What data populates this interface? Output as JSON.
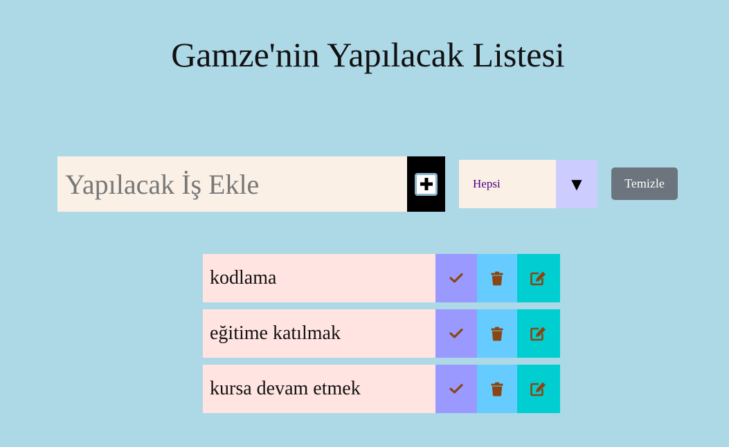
{
  "title": "Gamze'nin Yapılacak Listesi",
  "form": {
    "input_placeholder": "Yapılacak İş Ekle",
    "input_value": "",
    "add_icon": "plus-square-icon"
  },
  "filter": {
    "selected": "Hepsi",
    "arrow_icon": "triangle-down-icon"
  },
  "clear_button_label": "Temizle",
  "todos": [
    {
      "text": "kodlama"
    },
    {
      "text": "eğitime katılmak"
    },
    {
      "text": "kursa devam etmek"
    }
  ],
  "icons": {
    "complete": "check-icon",
    "delete": "trash-icon",
    "edit": "edit-icon"
  },
  "colors": {
    "background": "#add8e6",
    "input_bg": "#faf0e6",
    "item_bg": "#ffe4e1",
    "complete_bg": "#9999ff",
    "delete_bg": "#66ccff",
    "edit_bg": "#00ced1",
    "icon_color": "#8b4513",
    "clear_bg": "#6c757d"
  }
}
